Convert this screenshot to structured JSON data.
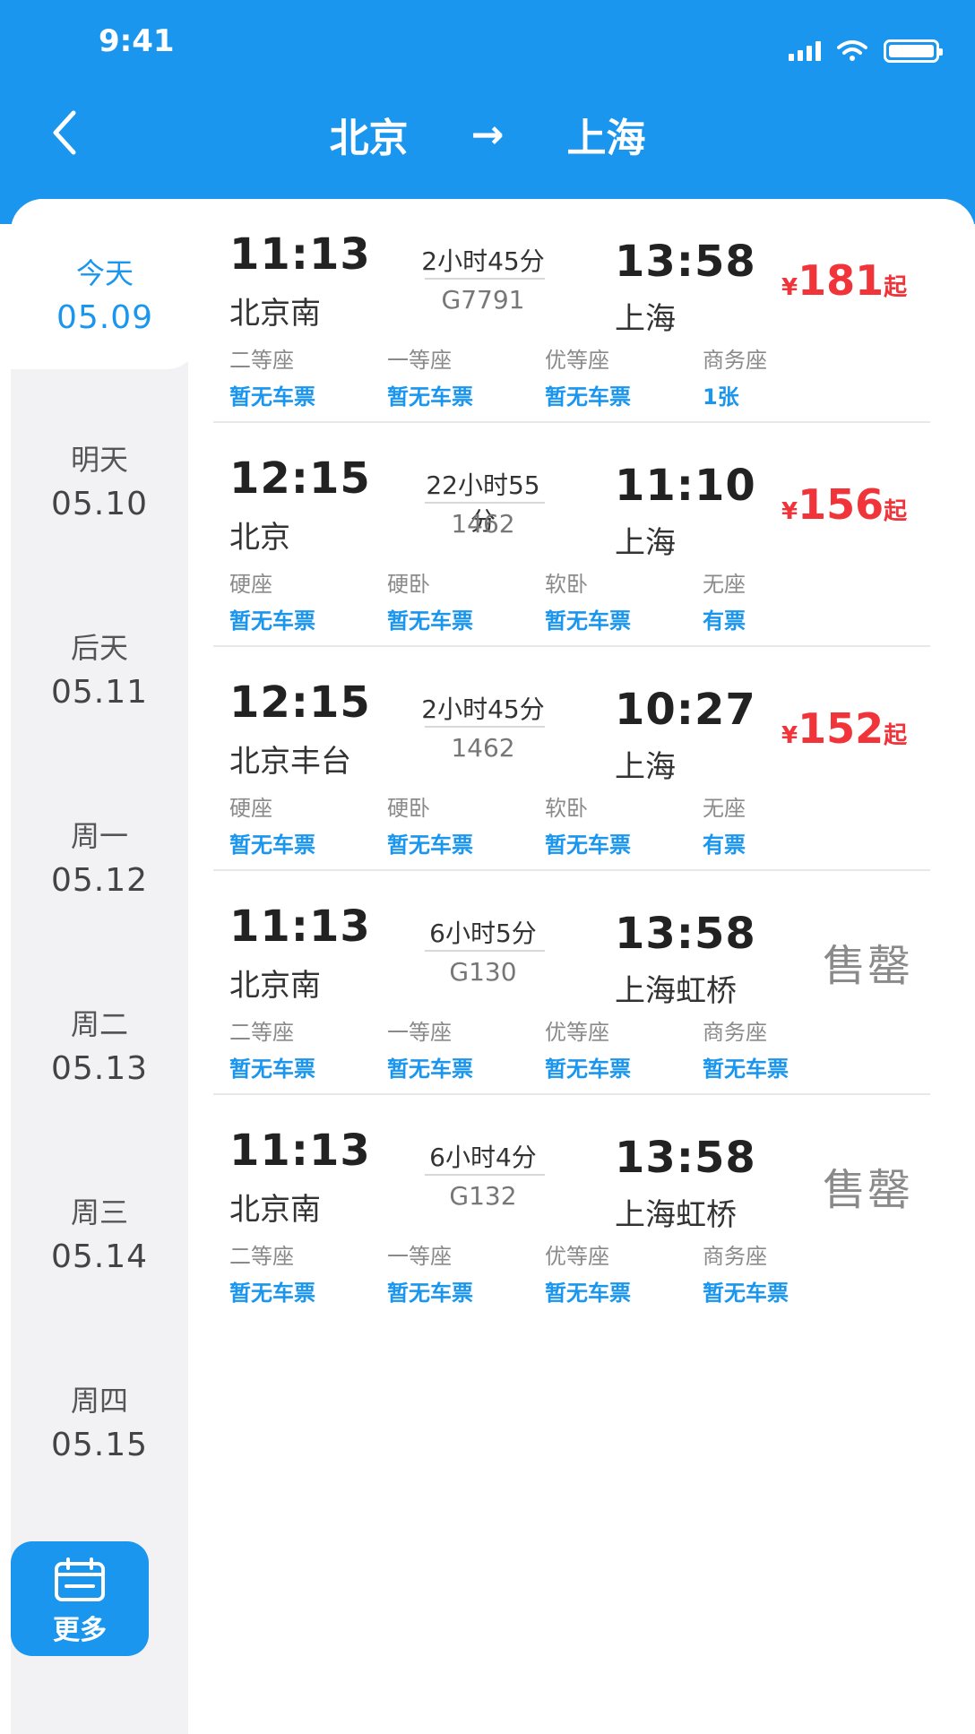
{
  "status_bar": {
    "time": "9:41"
  },
  "header": {
    "from": "北京",
    "arrow": "→",
    "to": "上海"
  },
  "dates": [
    {
      "day": "今天",
      "md": "05.09",
      "active": true
    },
    {
      "day": "明天",
      "md": "05.10"
    },
    {
      "day": "后天",
      "md": "05.11"
    },
    {
      "day": "周一",
      "md": "05.12"
    },
    {
      "day": "周二",
      "md": "05.13"
    },
    {
      "day": "周三",
      "md": "05.14"
    },
    {
      "day": "周四",
      "md": "05.15"
    }
  ],
  "more_button": {
    "label": "更多",
    "icon": "calendar-icon"
  },
  "trains": [
    {
      "dep_time": "11:13",
      "dep_station": "北京南",
      "duration": "2小时45分",
      "train_no": "G7791",
      "arr_time": "13:58",
      "arr_station": "上海",
      "price": {
        "currency": "¥",
        "amount": "181",
        "suffix": "起"
      },
      "seats": [
        {
          "name": "二等座",
          "avail": "暂无车票"
        },
        {
          "name": "一等座",
          "avail": "暂无车票"
        },
        {
          "name": "优等座",
          "avail": "暂无车票"
        },
        {
          "name": "商务座",
          "avail": "1张"
        }
      ]
    },
    {
      "dep_time": "12:15",
      "dep_station": "北京",
      "duration": "22小时55分",
      "train_no": "1462",
      "arr_time": "11:10",
      "arr_station": "上海",
      "price": {
        "currency": "¥",
        "amount": "156",
        "suffix": "起"
      },
      "seats": [
        {
          "name": "硬座",
          "avail": "暂无车票"
        },
        {
          "name": "硬卧",
          "avail": "暂无车票"
        },
        {
          "name": "软卧",
          "avail": "暂无车票"
        },
        {
          "name": "无座",
          "avail": "有票"
        }
      ]
    },
    {
      "dep_time": "12:15",
      "dep_station": "北京丰台",
      "duration": "2小时45分",
      "train_no": "1462",
      "arr_time": "10:27",
      "arr_station": "上海",
      "price": {
        "currency": "¥",
        "amount": "152",
        "suffix": "起"
      },
      "seats": [
        {
          "name": "硬座",
          "avail": "暂无车票"
        },
        {
          "name": "硬卧",
          "avail": "暂无车票"
        },
        {
          "name": "软卧",
          "avail": "暂无车票"
        },
        {
          "name": "无座",
          "avail": "有票"
        }
      ]
    },
    {
      "dep_time": "11:13",
      "dep_station": "北京南",
      "duration": "6小时5分",
      "train_no": "G130",
      "arr_time": "13:58",
      "arr_station": "上海虹桥",
      "sold_out": "售罄",
      "seats": [
        {
          "name": "二等座",
          "avail": "暂无车票"
        },
        {
          "name": "一等座",
          "avail": "暂无车票"
        },
        {
          "name": "优等座",
          "avail": "暂无车票"
        },
        {
          "name": "商务座",
          "avail": "暂无车票"
        }
      ]
    },
    {
      "dep_time": "11:13",
      "dep_station": "北京南",
      "duration": "6小时4分",
      "train_no": "G132",
      "arr_time": "13:58",
      "arr_station": "上海虹桥",
      "sold_out": "售罄",
      "seats": [
        {
          "name": "二等座",
          "avail": "暂无车票"
        },
        {
          "name": "一等座",
          "avail": "暂无车票"
        },
        {
          "name": "优等座",
          "avail": "暂无车票"
        },
        {
          "name": "商务座",
          "avail": "暂无车票"
        }
      ]
    }
  ],
  "colors": {
    "primary": "#1a96ef",
    "price": "#f0343a",
    "rail_bg": "#f2f2f4"
  }
}
